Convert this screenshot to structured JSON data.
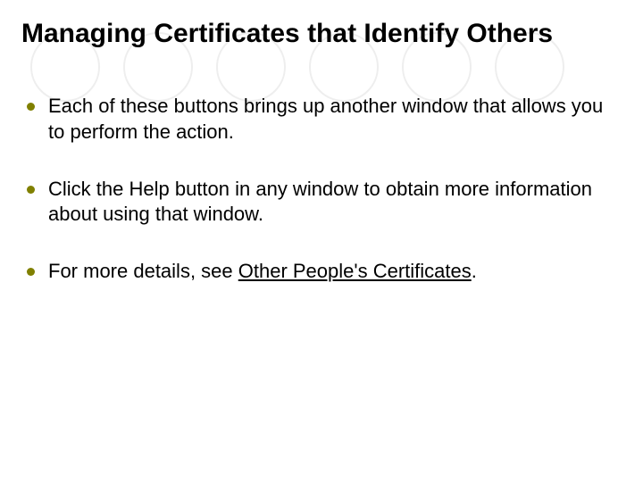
{
  "title": "Managing Certificates that Identify Others",
  "bullets": [
    {
      "text": "Each of these buttons brings up another window that allows you to perform the action."
    },
    {
      "text": "Click the Help button in any window to obtain more information about using that window."
    },
    {
      "prefix": " For more details, see ",
      "link": "Other People's Certificates",
      "suffix": "."
    }
  ]
}
